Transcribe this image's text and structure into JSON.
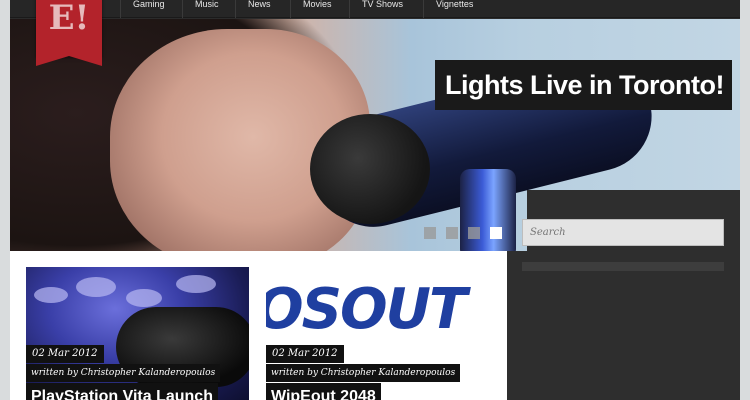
{
  "logo": {
    "text": "E!"
  },
  "nav": {
    "items": [
      {
        "label": "Gaming"
      },
      {
        "label": "Music"
      },
      {
        "label": "News"
      },
      {
        "label": "Movies"
      },
      {
        "label": "TV Shows"
      },
      {
        "label": "Vignettes"
      }
    ]
  },
  "hero": {
    "title": "Lights Live in Toronto!",
    "slides": {
      "count": 4,
      "active_index": 3
    }
  },
  "search": {
    "placeholder": "Search"
  },
  "posts": [
    {
      "date": "02 Mar 2012",
      "author": "written by Christopher Kalanderopoulos",
      "title": "PlayStation Vita Launch"
    },
    {
      "date": "02 Mar 2012",
      "author": "written by Christopher Kalanderopoulos",
      "title": "WipEout 2048",
      "image_text": "OSOUT"
    }
  ],
  "colors": {
    "logo_bg": "#b3232b",
    "nav_bg": "#262626",
    "sidebar_bg": "#2e2e2e",
    "caption_bg": "#111111"
  }
}
